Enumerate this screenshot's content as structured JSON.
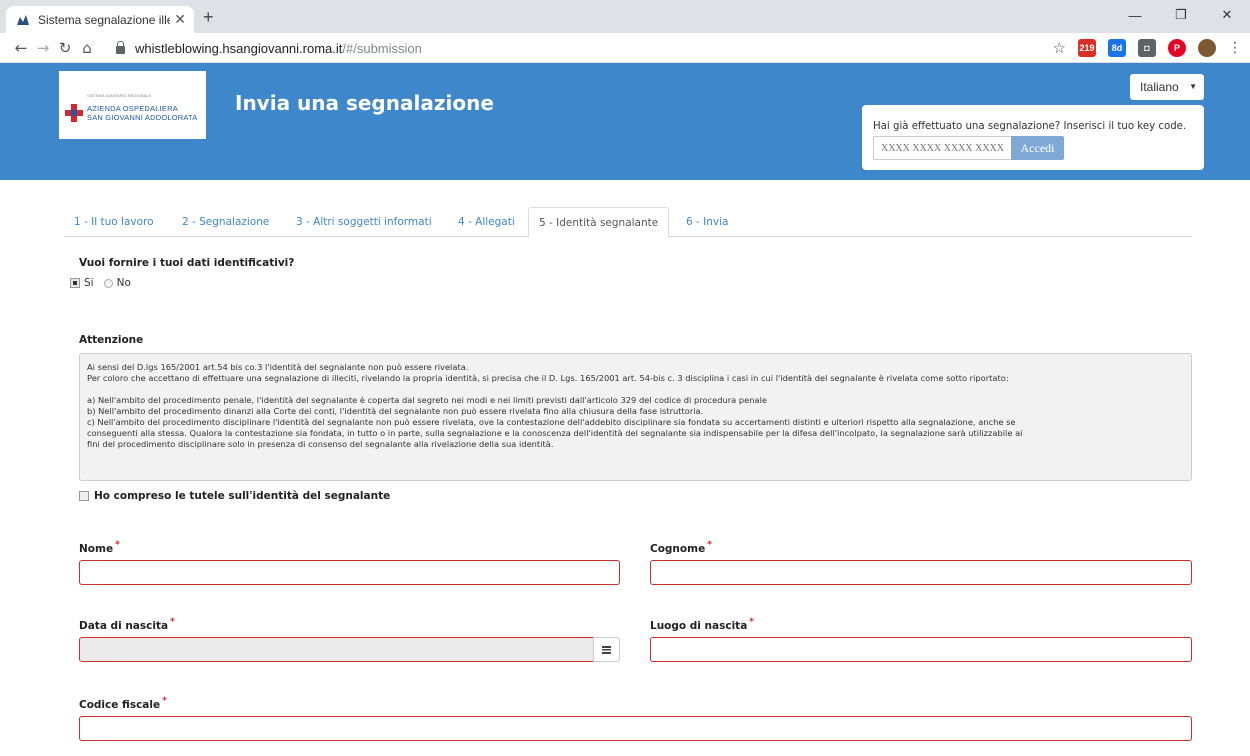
{
  "browser": {
    "tab_title": "Sistema segnalazione illeciti - Inv",
    "url_host": "whistleblowing.hsangiovanni.roma.it",
    "url_path": "/#/submission",
    "ext_badge_1": "219",
    "ext_badge_2": "8d"
  },
  "header": {
    "logo_small": "SISTEMA SANITARIO REGIONALE",
    "logo_line1": "AZIENDA OSPEDALIERA",
    "logo_line2": "SAN GIOVANNI ADDOLORATA",
    "title": "Invia una segnalazione",
    "language": "Italiano",
    "keycode_label": "Hai già effettuato una segnalazione? Inserisci il tuo key code.",
    "keycode_placeholder": "XXXX XXXX XXXX XXXX",
    "keycode_button": "Accedi",
    "accent_color": "#3f87cb"
  },
  "steps": [
    {
      "label": "1 - Il tuo lavoro"
    },
    {
      "label": "2 - Segnalazione"
    },
    {
      "label": "3 - Altri soggetti informati"
    },
    {
      "label": "4 - Allegati"
    },
    {
      "label": "5 - Identità segnalante",
      "active": true
    },
    {
      "label": "6 - Invia"
    }
  ],
  "identity": {
    "question": "Vuoi fornire i tuoi dati identificativi?",
    "option_yes": "Si",
    "option_no": "No",
    "selected": "Si"
  },
  "attention": {
    "title": "Attenzione",
    "line1": "Ai sensi del D.lgs 165/2001 art.54 bis co.3 l'identità del segnalante non può essere rivelata.",
    "line2": "Per coloro che accettano di effettuare una segnalazione di illeciti, rivelando la propria identità, si precisa che il D. Lgs. 165/2001 art. 54-bis c. 3 disciplina i casi in cui l'identità del segnalante è rivelata come sotto riportato:",
    "line3": "a) Nell'ambito del procedimento penale, l'identità del segnalante è coperta dal segreto nei modi e nei limiti previsti dall'articolo 329 del codice di procedura penale",
    "line4": "b) Nell'ambito del procedimento dinanzi alla Corte dei conti, l'identità del segnalante non può essere rivelata fino alla chiusura della fase istruttoria.",
    "line5": "c) Nell'ambito del procedimento disciplinare l'identità del segnalante non può essere rivelata, ove la contestazione dell'addebito disciplinare sia fondata su accertamenti distinti e ulteriori rispetto alla segnalazione, anche se",
    "line6": "conseguenti alla stessa. Qualora la contestazione sia fondata, in tutto o in parte, sulla segnalazione e la conoscenza dell'identità del segnalante sia indispensabile per la difesa dell'incolpato, la segnalazione sarà utilizzabile ai",
    "line7": "fini del procedimento disciplinare solo in presenza di consenso del segnalante alla rivelazione della sua identità."
  },
  "consent": {
    "label": "Ho compreso le tutele sull'identità del segnalante",
    "checked": false
  },
  "form": {
    "nome": "Nome",
    "cognome": "Cognome",
    "data_nascita": "Data di nascita",
    "luogo_nascita": "Luogo di nascita",
    "codice_fiscale": "Codice fiscale",
    "required_mark": "*"
  }
}
